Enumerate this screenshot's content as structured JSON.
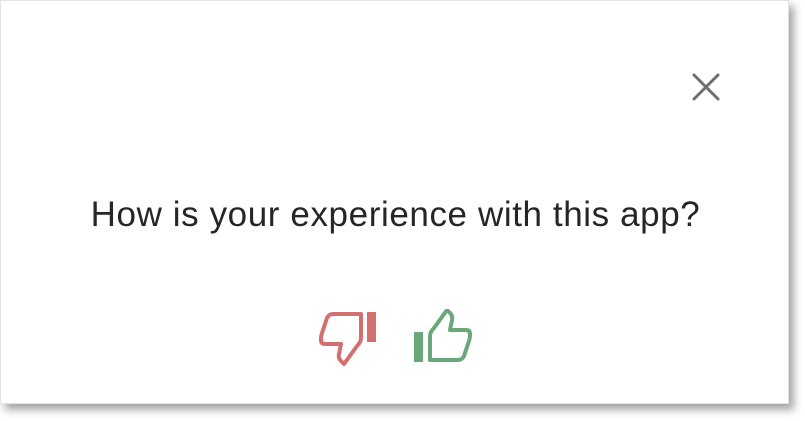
{
  "dialog": {
    "question": "How is your experience with this app?",
    "close_icon": "close-icon",
    "thumbs_down_icon": "thumbs-down-icon",
    "thumbs_up_icon": "thumbs-up-icon"
  },
  "colors": {
    "thumbs_down": "#d46f6f",
    "thumbs_up": "#6aa77a",
    "close": "#6e6e6e",
    "text": "#262626"
  }
}
